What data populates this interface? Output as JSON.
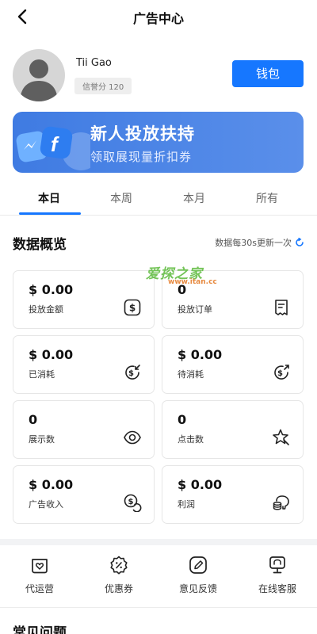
{
  "header": {
    "title": "广告中心"
  },
  "profile": {
    "name": "Tii Gao",
    "credit": "信誉分 120",
    "wallet_label": "钱包"
  },
  "banner": {
    "title": "新人投放扶持",
    "subtitle": "领取展现量折扣券"
  },
  "tabs": [
    {
      "label": "本日",
      "active": true
    },
    {
      "label": "本周",
      "active": false
    },
    {
      "label": "本月",
      "active": false
    },
    {
      "label": "所有",
      "active": false
    }
  ],
  "overview": {
    "title": "数据概览",
    "refresh_note": "数据每30s更新一次",
    "cards": [
      {
        "value": "$ 0.00",
        "label": "投放金额",
        "icon": "dollar-square-icon"
      },
      {
        "value": "0",
        "label": "投放订单",
        "icon": "receipt-icon"
      },
      {
        "value": "$ 0.00",
        "label": "已消耗",
        "icon": "coin-arrow-in-icon"
      },
      {
        "value": "$ 0.00",
        "label": "待消耗",
        "icon": "coin-arrow-out-icon"
      },
      {
        "value": "0",
        "label": "展示数",
        "icon": "eye-icon"
      },
      {
        "value": "0",
        "label": "点击数",
        "icon": "star-click-icon"
      },
      {
        "value": "$ 0.00",
        "label": "广告收入",
        "icon": "coin-stack-icon"
      },
      {
        "value": "$ 0.00",
        "label": "利润",
        "icon": "piggy-coins-icon"
      }
    ]
  },
  "tools": [
    {
      "label": "代运营",
      "icon": "heart-box-icon"
    },
    {
      "label": "优惠券",
      "icon": "discount-badge-icon"
    },
    {
      "label": "意见反馈",
      "icon": "edit-icon"
    },
    {
      "label": "在线客服",
      "icon": "support-icon"
    }
  ],
  "faq": {
    "title": "常见问题"
  },
  "watermark": {
    "text": "爱探之家",
    "url": "www.itan.cc"
  },
  "colors": {
    "primary": "#1677ff",
    "banner": "#4a84e6"
  }
}
